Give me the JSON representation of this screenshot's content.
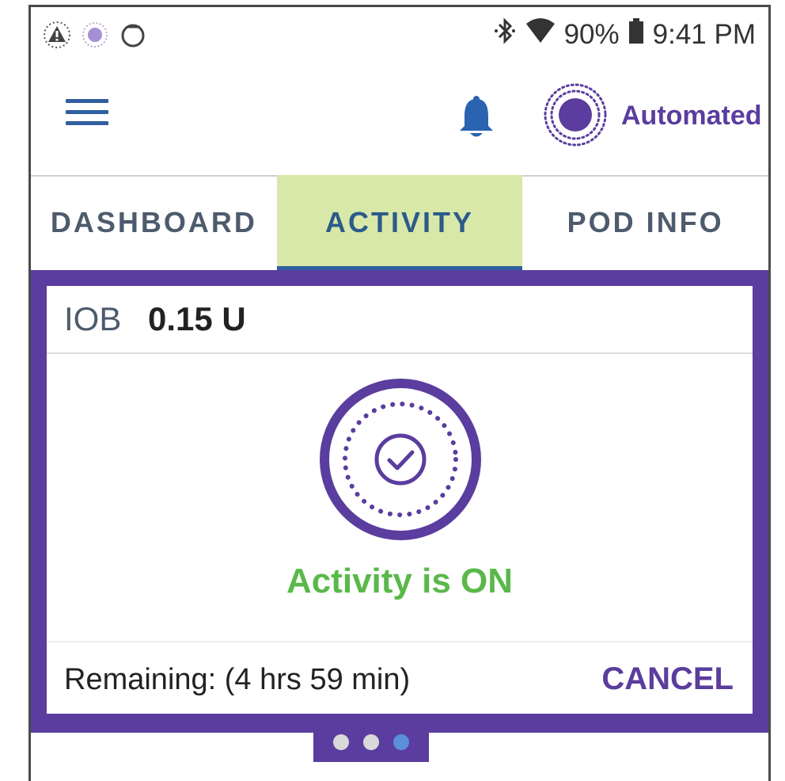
{
  "status_bar": {
    "left_icons": [
      "warning-icon",
      "ring-icon",
      "circle-outline-icon"
    ],
    "right_icons": [
      "bluetooth-icon",
      "wifi-icon",
      "battery-icon"
    ],
    "battery": "90%",
    "time": "9:41 PM"
  },
  "header": {
    "mode_label": "Automated",
    "icons": [
      "hamburger-menu-icon",
      "bell-icon",
      "automated-mode-icon"
    ]
  },
  "tabs": [
    {
      "label": "DASHBOARD",
      "active": false
    },
    {
      "label": "ACTIVITY",
      "active": true
    },
    {
      "label": "POD INFO",
      "active": false
    }
  ],
  "card": {
    "iob_label": "IOB",
    "iob_value": "0.15 U",
    "activity_status": "Activity is ON",
    "remaining": "Remaining: (4 hrs 59 min)",
    "cancel_label": "CANCEL"
  },
  "pager": {
    "count": 3,
    "active_index": 2
  },
  "colors": {
    "purple": "#5a3d9e",
    "tab_active_bg": "#d8e8a8",
    "blue": "#2f5f9e",
    "green": "#5ab84a"
  }
}
